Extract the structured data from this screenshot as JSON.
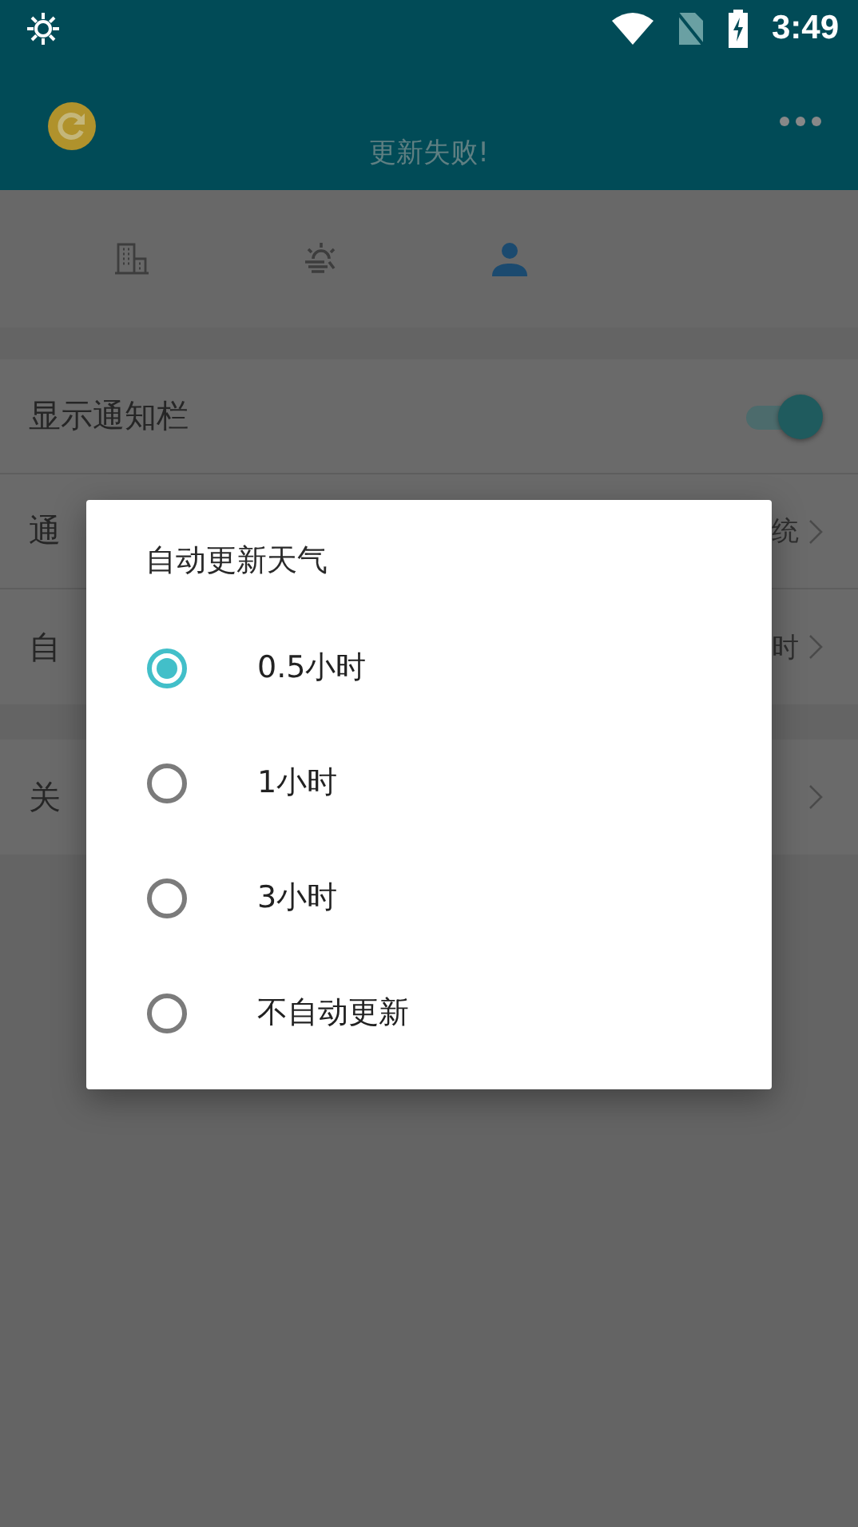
{
  "status_bar": {
    "time": "3:49"
  },
  "header": {
    "status": "更新失败!"
  },
  "tabs": [
    {
      "selected": false
    },
    {
      "selected": false
    },
    {
      "selected": true
    }
  ],
  "sections": [
    {
      "rows": [
        {
          "kind": "toggle",
          "label": "显示通知栏",
          "on": true
        },
        {
          "kind": "link",
          "label": "通",
          "value": "统"
        },
        {
          "kind": "link",
          "label": "自",
          "value": "时"
        }
      ]
    },
    {
      "rows": [
        {
          "kind": "link",
          "label": "关"
        }
      ]
    }
  ],
  "dialog": {
    "title": "自动更新天气",
    "options": [
      {
        "label": "0.5小时",
        "selected": true
      },
      {
        "label": "1小时",
        "selected": false
      },
      {
        "label": "3小时",
        "selected": false
      },
      {
        "label": "不自动更新",
        "selected": false
      }
    ]
  }
}
